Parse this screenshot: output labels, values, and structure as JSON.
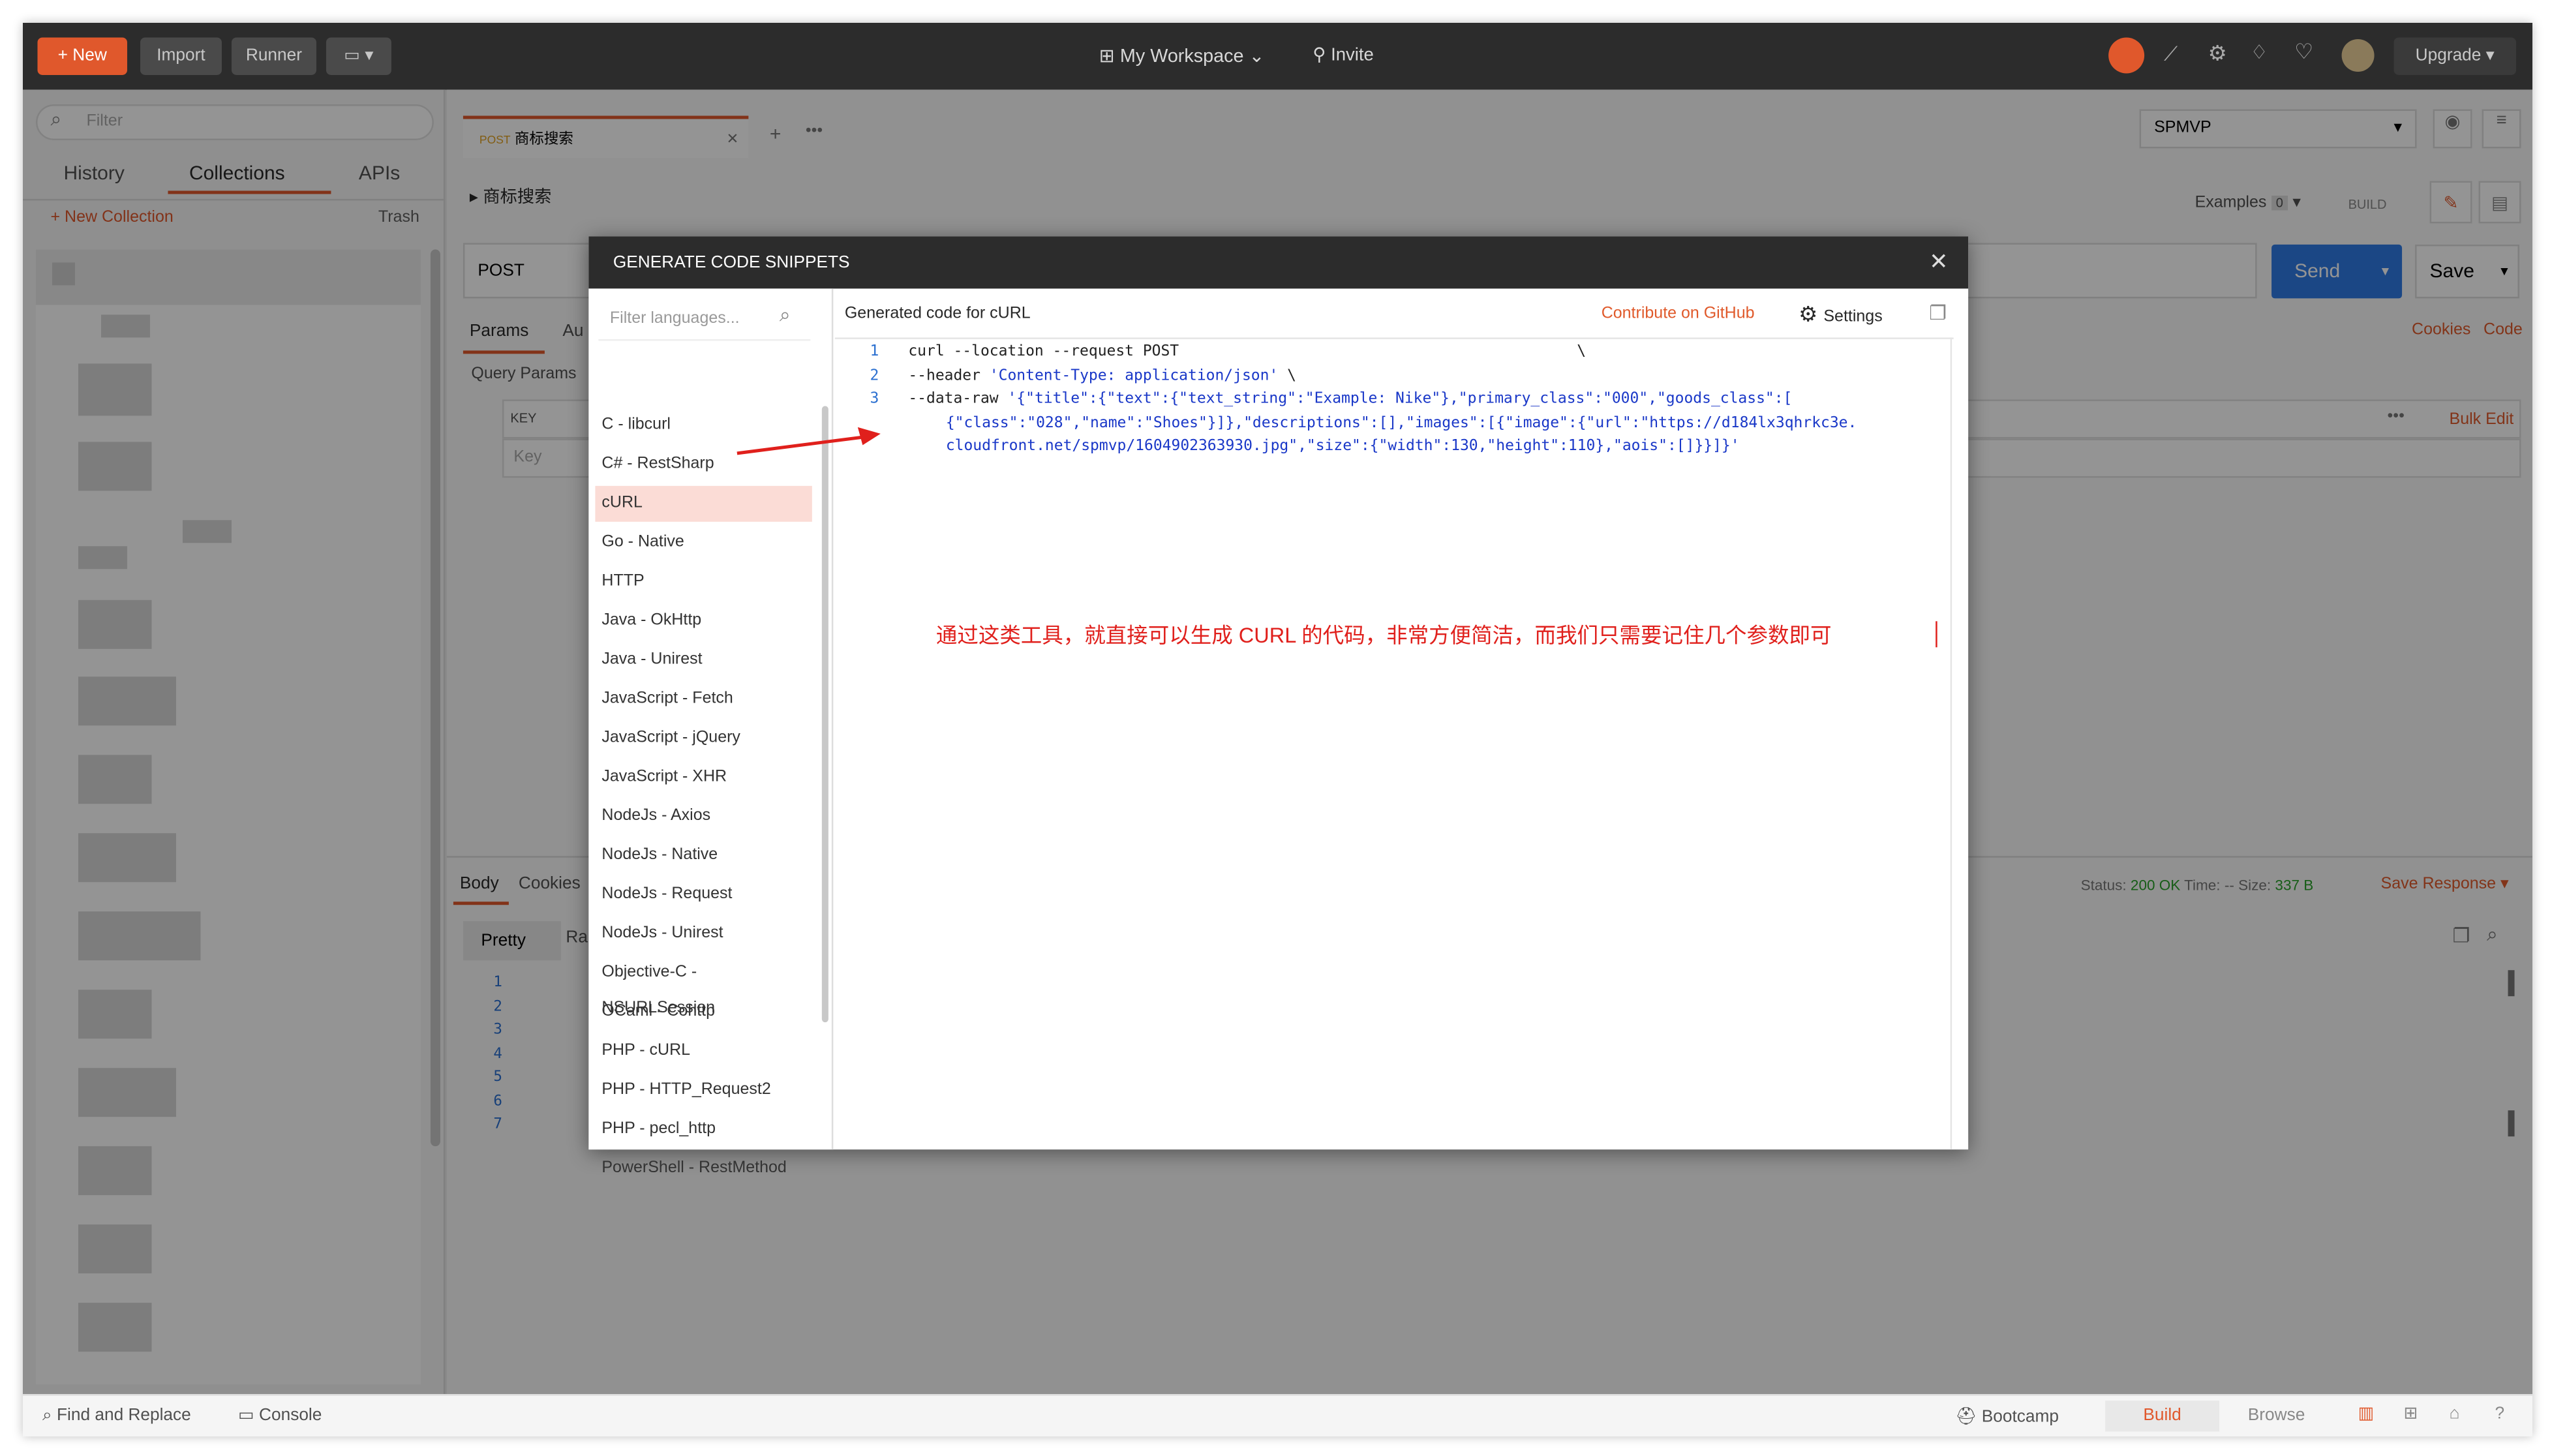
{
  "topbar": {
    "new_label": "New",
    "import_label": "Import",
    "runner_label": "Runner",
    "workspace_label": "My Workspace",
    "invite_label": "Invite",
    "upgrade_label": "Upgrade"
  },
  "sidebar": {
    "filter_placeholder": "Filter",
    "tabs": [
      "History",
      "Collections",
      "APIs"
    ],
    "new_collection": "New Collection",
    "trash": "Trash"
  },
  "request_tab": {
    "method": "POST",
    "name": "商标搜索"
  },
  "breadcrumb": "商标搜索",
  "environment": "SPMVP",
  "examples_label": "Examples",
  "examples_count": "0",
  "build_label": "BUILD",
  "url_bar": {
    "method": "POST",
    "send": "Send",
    "save": "Save"
  },
  "req_tabs": [
    "Params",
    "Au"
  ],
  "links": {
    "cookies": "Cookies",
    "code": "Code",
    "bulk_edit": "Bulk Edit"
  },
  "query_params": {
    "title": "Query Params",
    "key_header": "KEY",
    "key_placeholder": "Key"
  },
  "response": {
    "tabs": [
      "Body",
      "Cookies"
    ],
    "status_label": "Status:",
    "status": "200 OK",
    "time_label": "Time:",
    "time": "--",
    "size_label": "Size:",
    "size": "337 B",
    "save_response": "Save Response",
    "pretty": "Pretty",
    "raw": "Ra",
    "lines": [
      "1",
      "2",
      "3",
      "4",
      "5",
      "6",
      "7"
    ]
  },
  "bottombar": {
    "find_replace": "Find and Replace",
    "console": "Console",
    "bootcamp": "Bootcamp",
    "build": "Build",
    "browse": "Browse"
  },
  "modal": {
    "title": "GENERATE CODE SNIPPETS",
    "filter_placeholder": "Filter languages...",
    "generated_for": "Generated code for cURL",
    "contribute": "Contribute on GitHub",
    "settings": "Settings",
    "languages": [
      "C - libcurl",
      "C# - RestSharp",
      "cURL",
      "Go - Native",
      "HTTP",
      "Java - OkHttp",
      "Java - Unirest",
      "JavaScript - Fetch",
      "JavaScript - jQuery",
      "JavaScript - XHR",
      "NodeJs - Axios",
      "NodeJs - Native",
      "NodeJs - Request",
      "NodeJs - Unirest",
      "Objective-C - NSURLSession",
      "OCaml - Cohttp",
      "PHP - cURL",
      "PHP - HTTP_Request2",
      "PHP - pecl_http",
      "PowerShell - RestMethod"
    ],
    "selected_language": "cURL",
    "code_line_numbers": [
      "1",
      "2",
      "3"
    ],
    "code": {
      "l1": "curl --location --request POST",
      "l1_end": "\\",
      "l2_a": "--header ",
      "l2_b": "'Content-Type: application/json'",
      "l2_c": " \\",
      "l3_a": "--data-raw ",
      "l3_b": "'{\"title\":{\"text\":{\"text_string\":\"Example: Nike\"},\"primary_class\":\"000\",\"goods_class\":[",
      "l3_c": "{\"class\":\"028\",\"name\":\"Shoes\"}]},\"descriptions\":[],\"images\":[{\"image\":{\"url\":\"https://d184lx3qhrkc3e.",
      "l3_d": "cloudfront.net/spmvp/1604902363930.jpg\",\"size\":{\"width\":130,\"height\":110},\"aois\":[]}}]}'"
    },
    "annotation": "通过这类工具，就直接可以生成 CURL 的代码，非常方便简洁，而我们只需要记住几个参数即可"
  },
  "colors": {
    "accent": "#f26b3a",
    "send_blue": "#2f7ae5",
    "annotation_red": "#e0201c",
    "link_orange": "#e05a2b"
  }
}
